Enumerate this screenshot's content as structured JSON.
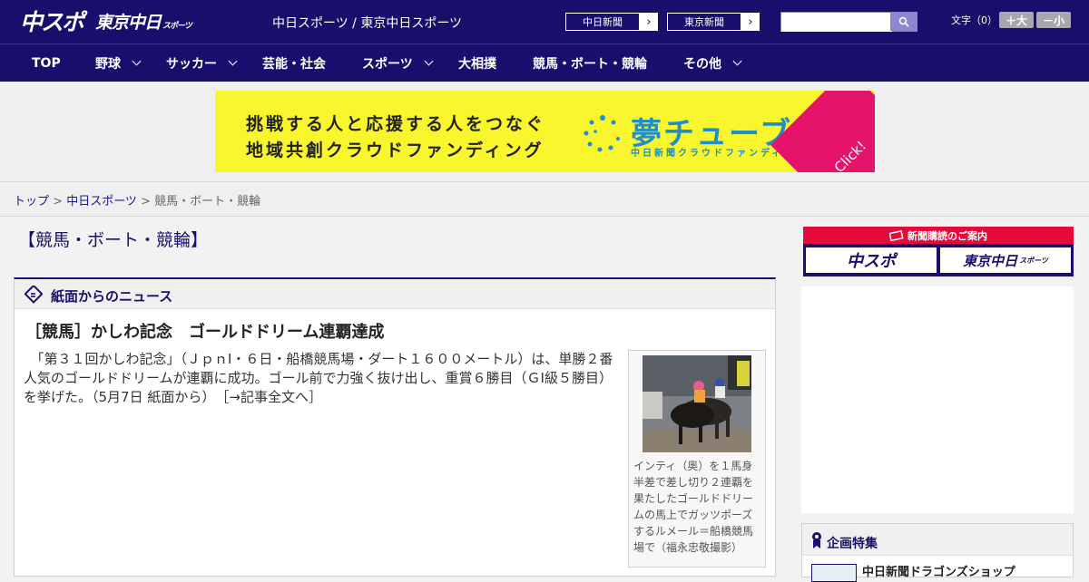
{
  "header": {
    "logo_main": "中スポ",
    "logo_tokyo": "東京中日",
    "logo_tokyo_small": "スポーツ",
    "site_name": "中日スポーツ / 東京中日スポーツ",
    "paper_buttons": [
      {
        "label": "中日新聞"
      },
      {
        "label": "東京新聞"
      }
    ],
    "search": {
      "placeholder": "",
      "value": ""
    },
    "font_size_label": "文字（0）",
    "font_plus": "＋大",
    "font_minus": "－小"
  },
  "nav": {
    "items": [
      {
        "label": "TOP",
        "has_dropdown": false
      },
      {
        "label": "野球",
        "has_dropdown": true
      },
      {
        "label": "サッカー",
        "has_dropdown": true
      },
      {
        "label": "芸能・社会",
        "has_dropdown": false
      },
      {
        "label": "スポーツ",
        "has_dropdown": true
      },
      {
        "label": "大相撲",
        "has_dropdown": false
      },
      {
        "label": "競馬・ボート・競輪",
        "has_dropdown": false
      },
      {
        "label": "その他",
        "has_dropdown": true
      }
    ]
  },
  "banner": {
    "line1": "挑戦する人と応援する人をつなぐ",
    "line2": "地域共創クラウドファンディング",
    "brand": "夢チューブ",
    "brand_sub": "中日新聞クラウドファンディング",
    "cta": "Click!"
  },
  "breadcrumb": {
    "top": "トップ",
    "sep1": " > ",
    "section": "中日スポーツ",
    "sep2": " > ",
    "current": "競馬・ボート・競輪"
  },
  "page": {
    "heading": "【競馬・ボート・競輪】"
  },
  "article_panel": {
    "title": "紙面からのニュース",
    "headline": "［競馬］かしわ記念　ゴールドドリーム連覇達成",
    "body": "　「第３１回かしわ記念」（ＪｐｎⅠ・６日・船橋競馬場・ダート１６００メートル）は、単勝２番人気のゴールドドリームが連覇に成功。ゴール前で力強く抜け出し、重賞６勝目（ＧⅠ級５勝目）を挙げた。（5月7日 紙面から）",
    "more_link": "［→記事全文へ］",
    "photo_caption": "インティ（奥）を１馬身半差で差し切り２連覇を果たしたゴールドドリームの馬上でガッツポーズするルメール＝船橋競馬場で（福永忠敬撮影）"
  },
  "sidebar": {
    "subscription_head": "新聞購読のご案内",
    "sub_logo_1": "中スポ",
    "sub_logo_2": "東京中日",
    "sub_logo_2_small": "スポーツ",
    "feature_title": "企画特集",
    "feature_item": "中日新聞ドラゴンズショップ"
  },
  "colors": {
    "brand_navy": "#170f6b",
    "banner_yellow": "#f9f62e",
    "banner_cta_pink": "#e5136a",
    "subscription_red": "#e40a3c"
  }
}
